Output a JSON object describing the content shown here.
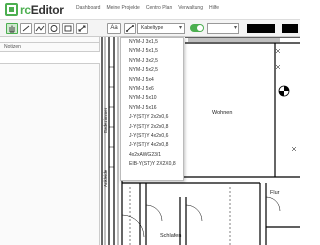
{
  "app": {
    "logo_prefix": "rc",
    "logo_rest": "Editor"
  },
  "nav": [
    "Dashboard",
    "Meine Projekte",
    "Centro Plan",
    "Verwaltung",
    "Hilfe"
  ],
  "toolbar": {
    "tools": [
      "select-tool",
      "line-tool",
      "polyline-tool",
      "circle-tool",
      "rectangle-tool",
      "dimension-tool",
      "text-tool"
    ],
    "text_tool_label": "Aa",
    "cable_type_label": "Kabeltype",
    "toggle_on": true
  },
  "left_panel": {
    "notes_title": "Notizen"
  },
  "cable_types": [
    "NYM-J 3x1,5",
    "NYM-J 5x1,5",
    "NYM-J 3x2,5",
    "NYM-J 5x2,5",
    "NYM-J 5x4",
    "NYM-J 5x6",
    "NYM-J 5x10",
    "NYM-J 5x16",
    "J-Y(ST)Y 2x2x0,6",
    "J-Y(ST)Y 2x2x0,8",
    "J-Y(ST)Y 4x2x0,6",
    "J-Y(ST)Y 4x2x0,8",
    "4x2xAWG23/1",
    "EIB-Y(ST)Y 2X2X0,8"
  ],
  "floor_plan": {
    "rooms": {
      "living": "Wohnen",
      "hall": "Flur",
      "bedroom": "Schlafen"
    },
    "side_labels": {
      "bath": "Badezimmer",
      "wardrobe": "Ankleide"
    }
  },
  "colors": {
    "accent": "#4caf50",
    "line": "#000000"
  }
}
